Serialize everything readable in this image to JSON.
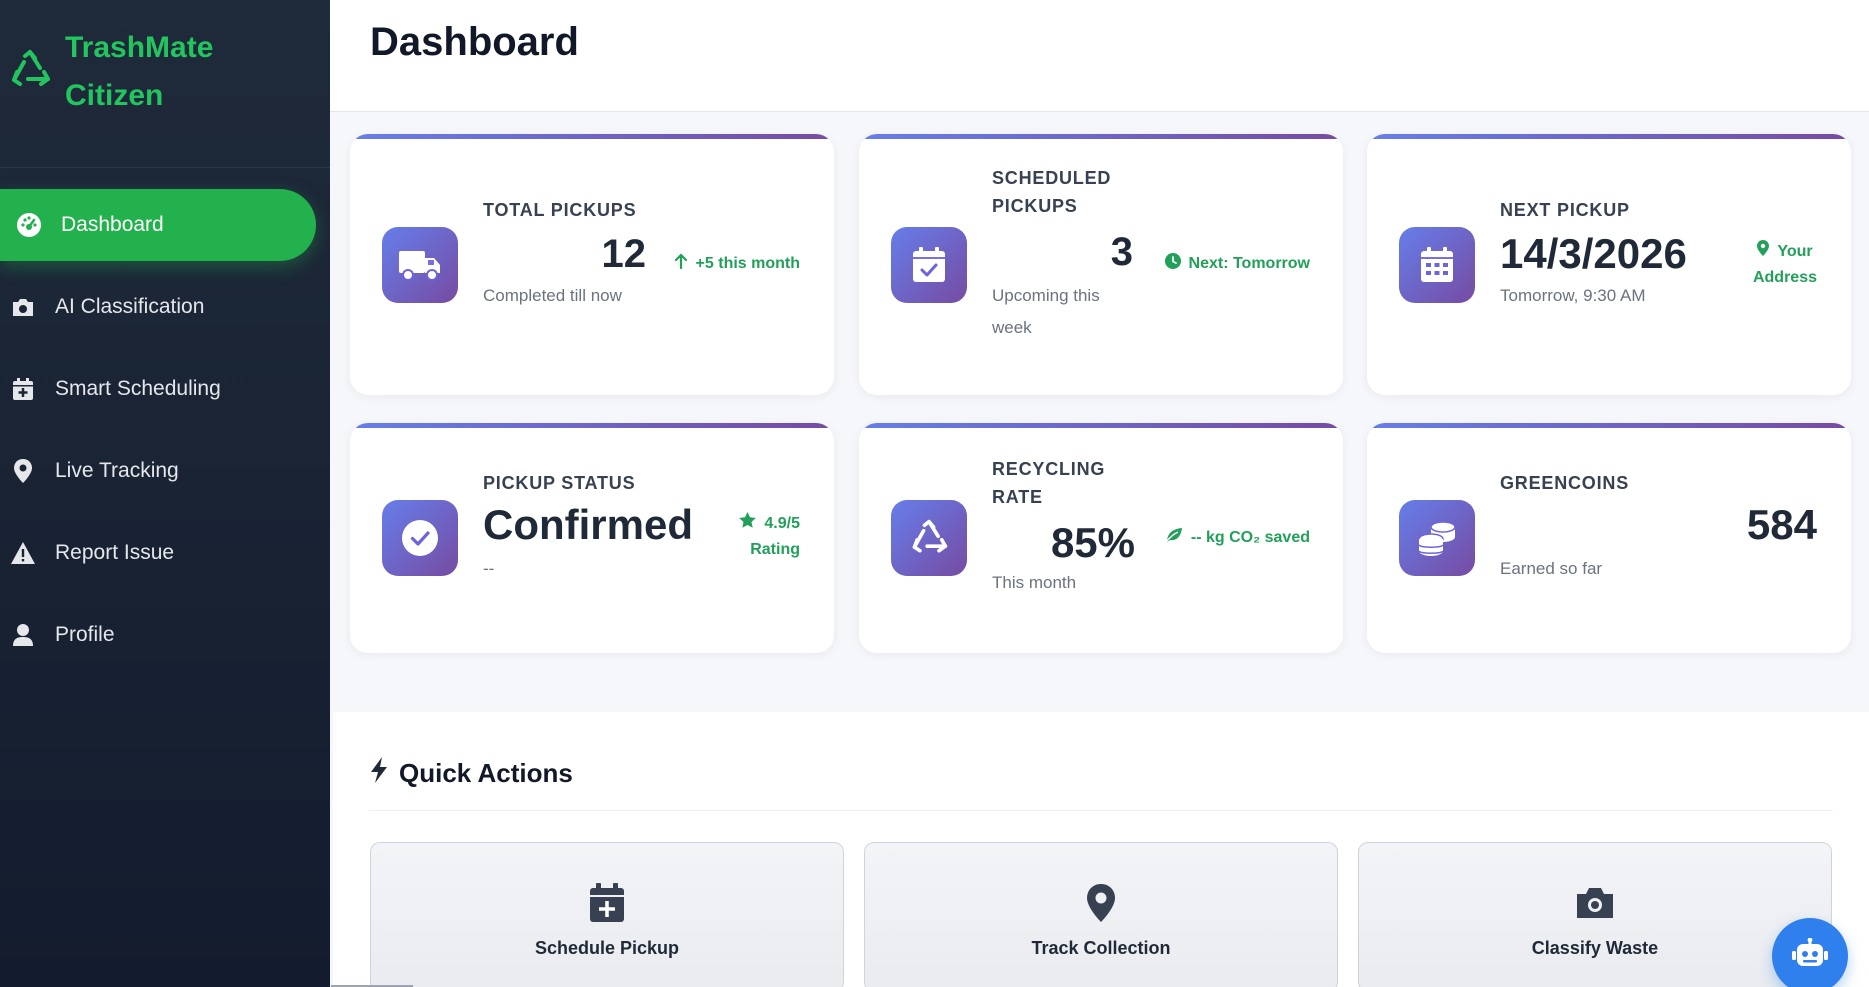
{
  "brand": {
    "line1": "TrashMate",
    "line2": "Citizen",
    "icon": "recycle-icon"
  },
  "sidebar": {
    "items": [
      {
        "label": "Dashboard",
        "icon": "gauge-icon",
        "active": true
      },
      {
        "label": "AI Classification",
        "icon": "camera-icon"
      },
      {
        "label": "Smart Scheduling",
        "icon": "calendar-plus-icon"
      },
      {
        "label": "Live Tracking",
        "icon": "map-pin-icon"
      },
      {
        "label": "Report Issue",
        "icon": "warning-icon"
      },
      {
        "label": "Profile",
        "icon": "user-icon"
      }
    ]
  },
  "header": {
    "title": "Dashboard"
  },
  "cards": {
    "total_pickups": {
      "label": "TOTAL PICKUPS",
      "value": "12",
      "trend": "+5 this month",
      "sub": "Completed till now"
    },
    "scheduled": {
      "label_line1": "SCHEDULED",
      "label_line2": "PICKUPS",
      "value": "3",
      "trend": "Next: Tomorrow",
      "sub_line1": "Upcoming this",
      "sub_line2": "week"
    },
    "next_pickup": {
      "label": "NEXT PICKUP",
      "value": "14/3/2026",
      "trend_line1": "Your",
      "trend_line2": "Address",
      "sub": "Tomorrow, 9:30 AM"
    },
    "status": {
      "label": "PICKUP STATUS",
      "value": "Confirmed",
      "trend_line1": "4.9/5",
      "trend_line2": "Rating",
      "sub": "--"
    },
    "recycling": {
      "label_line1": "RECYCLING",
      "label_line2": "RATE",
      "value": "85%",
      "trend": "-- kg CO₂ saved",
      "sub": "This month"
    },
    "greencoins": {
      "label": "GREENCOINS",
      "value": "584",
      "sub": "Earned so far"
    }
  },
  "quick_actions": {
    "title": "Quick Actions",
    "buttons": [
      {
        "label": "Schedule Pickup",
        "icon": "calendar-plus-icon"
      },
      {
        "label": "Track Collection",
        "icon": "map-pin-icon"
      },
      {
        "label": "Classify Waste",
        "icon": "camera-icon"
      }
    ]
  },
  "colors": {
    "brand_green": "#22c55e",
    "active_green": "#22b14c",
    "accent_start": "#667eea",
    "accent_end": "#764ba2",
    "trend_green": "#22a05a",
    "bot_blue": "#2f80ed"
  }
}
